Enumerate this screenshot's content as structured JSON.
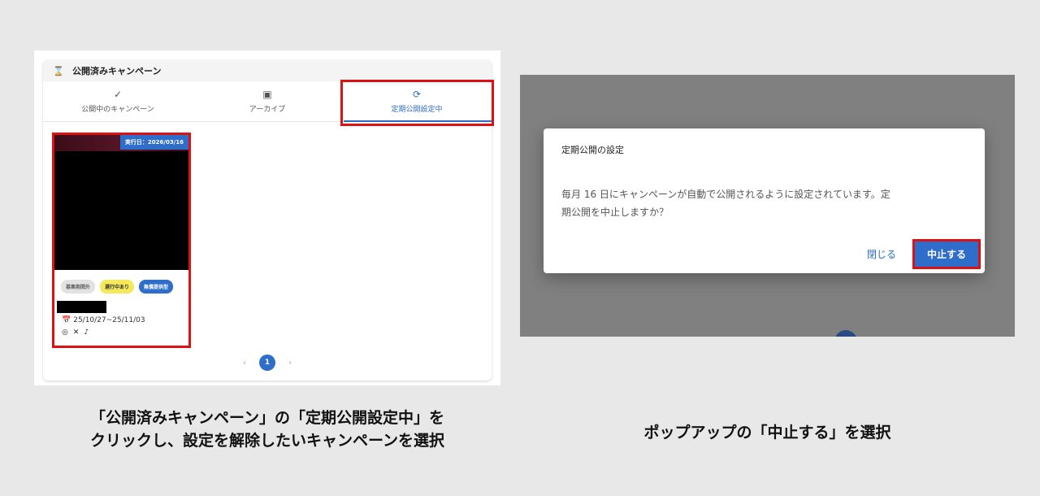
{
  "left": {
    "header_title": "公開済みキャンペーン",
    "tabs": [
      {
        "label": "公開中のキャンペーン",
        "icon": "check-icon"
      },
      {
        "label": "アーカイブ",
        "icon": "archive-icon"
      },
      {
        "label": "定期公開設定中",
        "icon": "sync-icon"
      }
    ],
    "active_tab": "定期公開設定中",
    "campaign": {
      "date_badge": "実行日：2026/03/16",
      "tags": [
        "募集期間外",
        "選行中あり",
        "無償提供型"
      ],
      "period": "25/10/27~25/11/03",
      "socials": [
        "instagram-icon",
        "x-icon",
        "tiktok-icon"
      ]
    },
    "pagination": {
      "prev": "‹",
      "current": "1",
      "next": "›"
    },
    "caption_line1": "「公開済みキャンペーン」の「定期公開設定中」を",
    "caption_line2": "クリックし、設定を解除したいキャンペーンを選択"
  },
  "right": {
    "dialog_title": "定期公開の設定",
    "dialog_body_line1": "毎月 16 日にキャンペーンが自動で公開されるように設定されています。定",
    "dialog_body_line2": "期公開を中止しますか？",
    "close_label": "閉じる",
    "stop_label": "中止する",
    "caption": "ポップアップの「中止する」を選択"
  },
  "colors": {
    "accent": "#2e6dc9",
    "highlight": "#dd1111",
    "overlay": "#808080"
  }
}
